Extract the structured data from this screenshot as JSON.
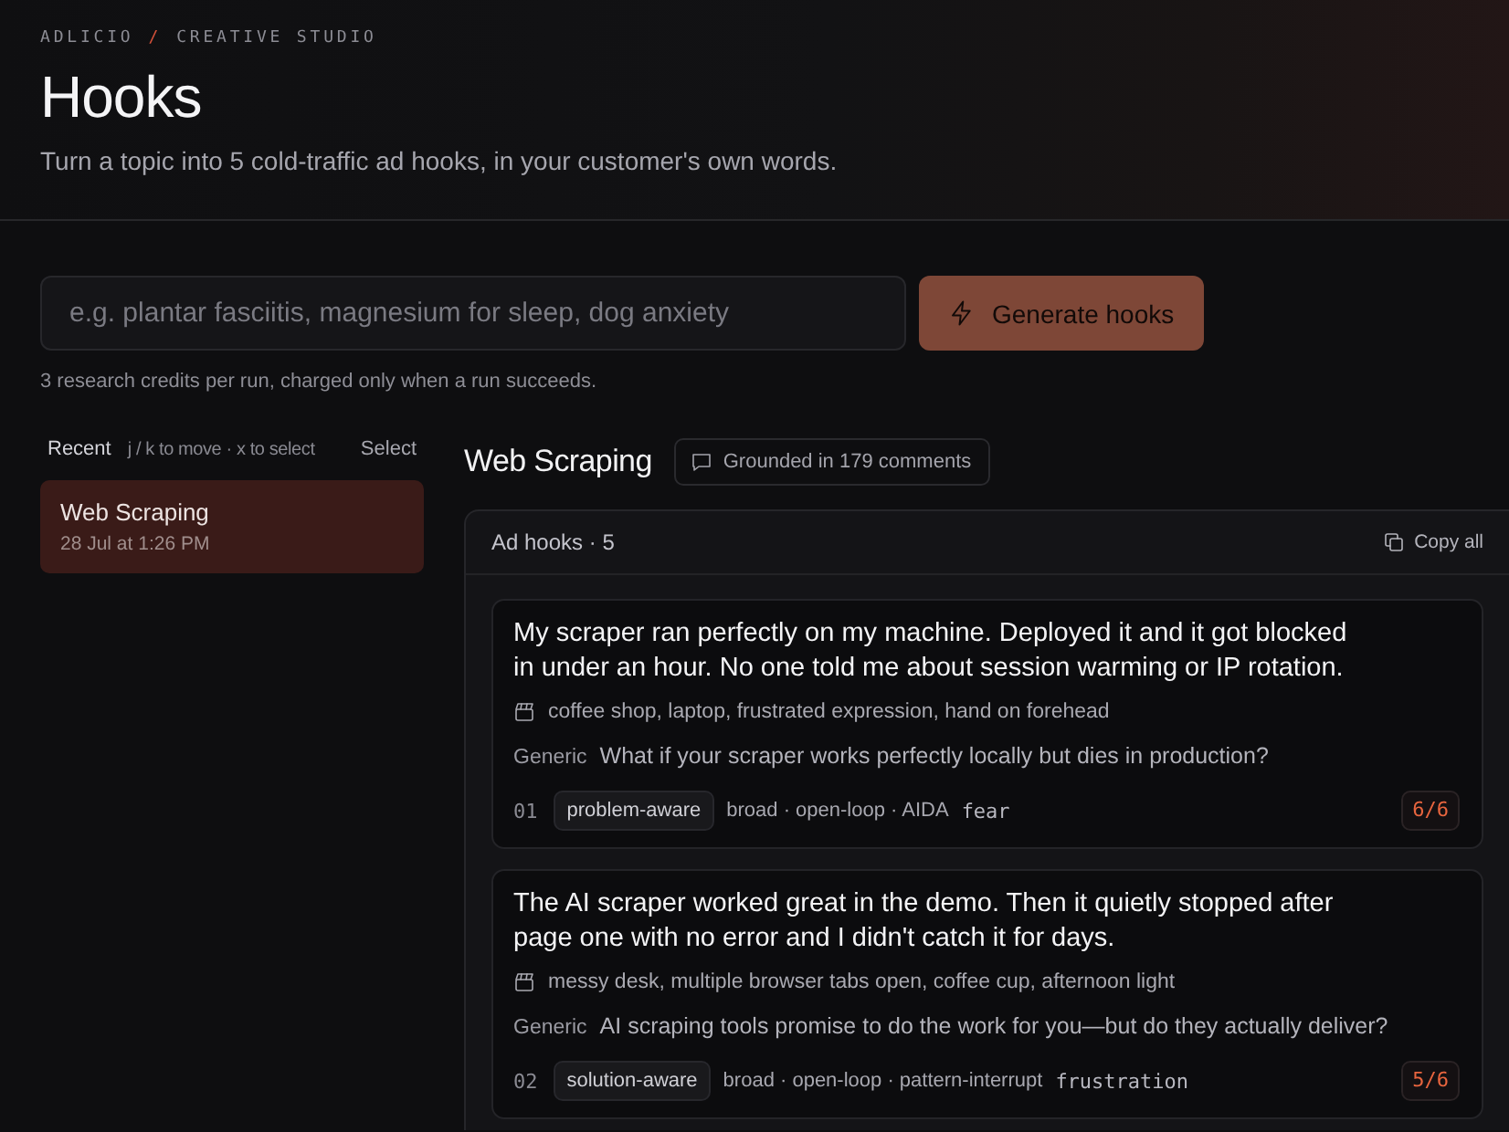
{
  "breadcrumb": {
    "brand": "ADLICIO",
    "separator": "/",
    "section": "CREATIVE STUDIO"
  },
  "page": {
    "title": "Hooks",
    "subtitle": "Turn a topic into 5 cold-traffic ad hooks, in your customer's own words."
  },
  "topic_form": {
    "placeholder": "e.g. plantar fasciitis, magnesium for sleep, dog anxiety",
    "generate_button": {
      "label": "Generate hooks",
      "disabled": true
    },
    "note": "3 research credits per run, charged only when a run succeeds."
  },
  "recent": {
    "title": "Recent",
    "hint": "j / k to move · x to select",
    "select_button": "Select",
    "items": [
      {
        "title": "Web Scraping",
        "date": "28 Jul at 1:26 PM",
        "selected": true
      }
    ]
  },
  "result": {
    "title": "Web Scraping",
    "grounding_badge": "Grounded in 179 comments",
    "panel": {
      "title": "Ad hooks · 5",
      "copy_button": "Copy all",
      "hooks": [
        {
          "headline": "My scraper ran perfectly on my machine. Deployed it and it got blocked in under an hour. No one told me about session warming or IP rotation.",
          "scene": "coffee shop, laptop, frustrated expression, hand on forehead",
          "generic_label": "Generic",
          "generic_text": "What if your scraper works perfectly locally but dies in production?",
          "number": "01",
          "awareness": "problem-aware",
          "attributes": "broad · open-loop · AIDA",
          "emotion": "fear",
          "score": "6/6"
        },
        {
          "headline": "The AI scraper worked great in the demo. Then it quietly stopped after page one with no error and I didn't catch it for days.",
          "scene": "messy desk, multiple browser tabs open, coffee cup, afternoon light",
          "generic_label": "Generic",
          "generic_text": "AI scraping tools promise to do the work for you—but do they actually deliver?",
          "number": "02",
          "awareness": "solution-aware",
          "attributes": "broad · open-loop · pattern-interrupt",
          "emotion": "frustration",
          "score": "5/6"
        }
      ]
    }
  }
}
